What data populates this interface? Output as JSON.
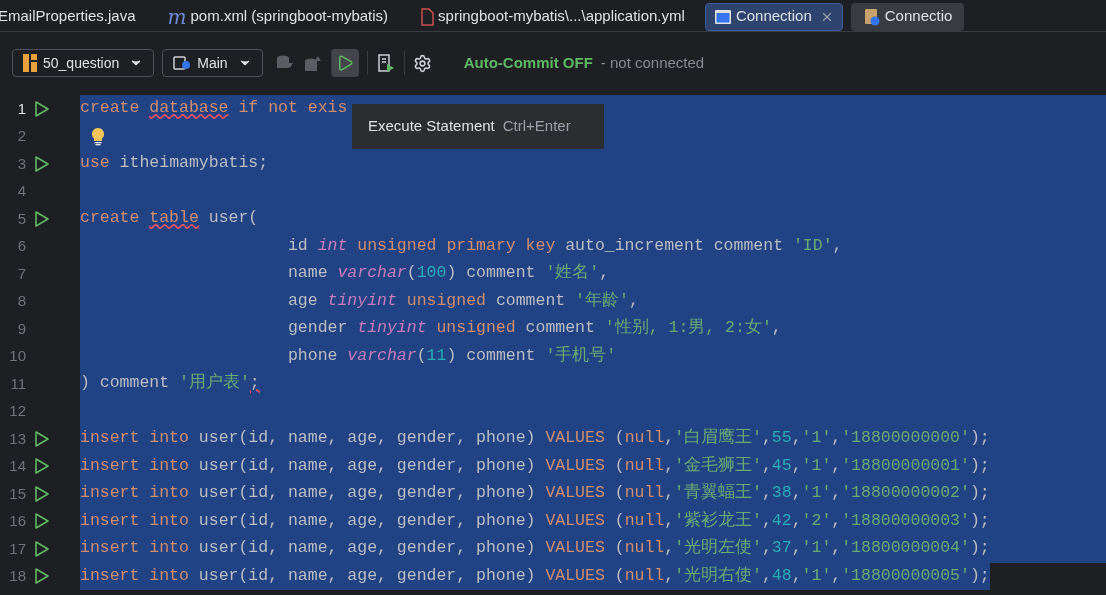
{
  "tabs": [
    {
      "label": "EmailProperties.java",
      "kind": "plain",
      "selected": false,
      "closable": false
    },
    {
      "label": "pom.xml (springboot-mybatis)",
      "kind": "maven",
      "glyph": "m",
      "selected": false,
      "closable": false
    },
    {
      "label": "springboot-mybatis\\...\\application.yml",
      "kind": "yaml",
      "selected": false,
      "closable": false
    },
    {
      "label": "Connection",
      "kind": "console",
      "selected": true,
      "closable": true
    },
    {
      "label": "Connectio",
      "kind": "datasource",
      "selected": false,
      "closable": false
    }
  ],
  "toolbar": {
    "datasource": "50_question",
    "schema": "Main",
    "commit_mode": "Auto-Commit OFF",
    "connection_status": "- not connected"
  },
  "tooltip": {
    "label": "Execute Statement",
    "shortcut": "Ctrl+Enter"
  },
  "lines": [
    {
      "number": "1",
      "run": true,
      "current": true,
      "bulb": false,
      "selected": true,
      "selection_to_edge": true,
      "tokens": [
        {
          "kind": "keyword",
          "text": "create "
        },
        {
          "kind": "keyword",
          "text": "database",
          "underline": true
        },
        {
          "kind": "keyword",
          "text": " if not exis"
        }
      ]
    },
    {
      "number": "2",
      "run": false,
      "current": false,
      "bulb": true,
      "selected": true,
      "selection_to_edge": true
    },
    {
      "number": "3",
      "run": true,
      "current": false,
      "bulb": false,
      "selected": true,
      "selection_to_edge": true,
      "tokens": [
        {
          "kind": "keyword",
          "text": "use"
        },
        {
          "kind": "plain",
          "text": " itheimamybatis;"
        }
      ]
    },
    {
      "number": "4",
      "run": false,
      "current": false,
      "bulb": false,
      "selected": true,
      "selection_to_edge": true
    },
    {
      "number": "5",
      "run": true,
      "current": false,
      "bulb": false,
      "selected": true,
      "selection_to_edge": true,
      "tokens": [
        {
          "kind": "keyword",
          "text": "create "
        },
        {
          "kind": "keyword",
          "text": "table",
          "underline": true
        },
        {
          "kind": "plain",
          "text": " user("
        }
      ]
    },
    {
      "number": "6",
      "run": false,
      "current": false,
      "bulb": false,
      "selected": true,
      "selection_to_edge": true,
      "tokens": [
        {
          "kind": "plain",
          "text": "                     id "
        },
        {
          "kind": "type",
          "text": "int"
        },
        {
          "kind": "keyword",
          "text": " unsigned primary key"
        },
        {
          "kind": "plain",
          "text": " auto_increment comment "
        },
        {
          "kind": "string",
          "text": "'ID'"
        },
        {
          "kind": "plain",
          "text": ","
        }
      ]
    },
    {
      "number": "7",
      "run": false,
      "current": false,
      "bulb": false,
      "selected": true,
      "selection_to_edge": true,
      "tokens": [
        {
          "kind": "plain",
          "text": "                     name "
        },
        {
          "kind": "type",
          "text": "varchar"
        },
        {
          "kind": "plain",
          "text": "("
        },
        {
          "kind": "number",
          "text": "100"
        },
        {
          "kind": "plain",
          "text": ") comment "
        },
        {
          "kind": "string",
          "text": "'姓名'"
        },
        {
          "kind": "plain",
          "text": ","
        }
      ]
    },
    {
      "number": "8",
      "run": false,
      "current": false,
      "bulb": false,
      "selected": true,
      "selection_to_edge": true,
      "tokens": [
        {
          "kind": "plain",
          "text": "                     age "
        },
        {
          "kind": "type",
          "text": "tinyint"
        },
        {
          "kind": "keyword",
          "text": " unsigned"
        },
        {
          "kind": "plain",
          "text": " comment "
        },
        {
          "kind": "string",
          "text": "'年龄'"
        },
        {
          "kind": "plain",
          "text": ","
        }
      ]
    },
    {
      "number": "9",
      "run": false,
      "current": false,
      "bulb": false,
      "selected": true,
      "selection_to_edge": true,
      "tokens": [
        {
          "kind": "plain",
          "text": "                     gender "
        },
        {
          "kind": "type",
          "text": "tinyint"
        },
        {
          "kind": "keyword",
          "text": " unsigned"
        },
        {
          "kind": "plain",
          "text": " comment "
        },
        {
          "kind": "string",
          "text": "'性别, 1:男, 2:女'"
        },
        {
          "kind": "plain",
          "text": ","
        }
      ]
    },
    {
      "number": "10",
      "run": false,
      "current": false,
      "bulb": false,
      "selected": true,
      "selection_to_edge": true,
      "tokens": [
        {
          "kind": "plain",
          "text": "                     phone "
        },
        {
          "kind": "type",
          "text": "varchar"
        },
        {
          "kind": "plain",
          "text": "("
        },
        {
          "kind": "number",
          "text": "11"
        },
        {
          "kind": "plain",
          "text": ") comment "
        },
        {
          "kind": "string",
          "text": "'手机号'"
        }
      ]
    },
    {
      "number": "11",
      "run": false,
      "current": false,
      "bulb": false,
      "selected": true,
      "selection_to_edge": true,
      "tokens": [
        {
          "kind": "plain",
          "text": ") comment "
        },
        {
          "kind": "string",
          "text": "'用户表'"
        },
        {
          "kind": "plain",
          "text": ";",
          "underline": true
        }
      ]
    },
    {
      "number": "12",
      "run": false,
      "current": false,
      "bulb": false,
      "selected": true,
      "selection_to_edge": true
    },
    {
      "number": "13",
      "run": true,
      "current": false,
      "bulb": false,
      "selected": true,
      "selection_to_edge": true,
      "tokens": [
        {
          "kind": "keyword",
          "text": "insert into"
        },
        {
          "kind": "plain",
          "text": " user(id, name, age, gender, phone) "
        },
        {
          "kind": "keyword",
          "text": "VALUES"
        },
        {
          "kind": "plain",
          "text": " ("
        },
        {
          "kind": "keyword",
          "text": "null"
        },
        {
          "kind": "plain",
          "text": ","
        },
        {
          "kind": "string",
          "text": "'白眉鹰王'"
        },
        {
          "kind": "plain",
          "text": ","
        },
        {
          "kind": "number",
          "text": "55"
        },
        {
          "kind": "plain",
          "text": ","
        },
        {
          "kind": "string",
          "text": "'1'"
        },
        {
          "kind": "plain",
          "text": ","
        },
        {
          "kind": "string",
          "text": "'18800000000'"
        },
        {
          "kind": "plain",
          "text": ");"
        }
      ]
    },
    {
      "number": "14",
      "run": true,
      "current": false,
      "bulb": false,
      "selected": true,
      "selection_to_edge": true,
      "tokens": [
        {
          "kind": "keyword",
          "text": "insert into"
        },
        {
          "kind": "plain",
          "text": " user(id, name, age, gender, phone) "
        },
        {
          "kind": "keyword",
          "text": "VALUES"
        },
        {
          "kind": "plain",
          "text": " ("
        },
        {
          "kind": "keyword",
          "text": "null"
        },
        {
          "kind": "plain",
          "text": ","
        },
        {
          "kind": "string",
          "text": "'金毛狮王'"
        },
        {
          "kind": "plain",
          "text": ","
        },
        {
          "kind": "number",
          "text": "45"
        },
        {
          "kind": "plain",
          "text": ","
        },
        {
          "kind": "string",
          "text": "'1'"
        },
        {
          "kind": "plain",
          "text": ","
        },
        {
          "kind": "string",
          "text": "'18800000001'"
        },
        {
          "kind": "plain",
          "text": ");"
        }
      ]
    },
    {
      "number": "15",
      "run": true,
      "current": false,
      "bulb": false,
      "selected": true,
      "selection_to_edge": true,
      "tokens": [
        {
          "kind": "keyword",
          "text": "insert into"
        },
        {
          "kind": "plain",
          "text": " user(id, name, age, gender, phone) "
        },
        {
          "kind": "keyword",
          "text": "VALUES"
        },
        {
          "kind": "plain",
          "text": " ("
        },
        {
          "kind": "keyword",
          "text": "null"
        },
        {
          "kind": "plain",
          "text": ","
        },
        {
          "kind": "string",
          "text": "'青翼蝠王'"
        },
        {
          "kind": "plain",
          "text": ","
        },
        {
          "kind": "number",
          "text": "38"
        },
        {
          "kind": "plain",
          "text": ","
        },
        {
          "kind": "string",
          "text": "'1'"
        },
        {
          "kind": "plain",
          "text": ","
        },
        {
          "kind": "string",
          "text": "'18800000002'"
        },
        {
          "kind": "plain",
          "text": ");"
        }
      ]
    },
    {
      "number": "16",
      "run": true,
      "current": false,
      "bulb": false,
      "selected": true,
      "selection_to_edge": true,
      "tokens": [
        {
          "kind": "keyword",
          "text": "insert into"
        },
        {
          "kind": "plain",
          "text": " user(id, name, age, gender, phone) "
        },
        {
          "kind": "keyword",
          "text": "VALUES"
        },
        {
          "kind": "plain",
          "text": " ("
        },
        {
          "kind": "keyword",
          "text": "null"
        },
        {
          "kind": "plain",
          "text": ","
        },
        {
          "kind": "string",
          "text": "'紫衫龙王'"
        },
        {
          "kind": "plain",
          "text": ","
        },
        {
          "kind": "number",
          "text": "42"
        },
        {
          "kind": "plain",
          "text": ","
        },
        {
          "kind": "string",
          "text": "'2'"
        },
        {
          "kind": "plain",
          "text": ","
        },
        {
          "kind": "string",
          "text": "'18800000003'"
        },
        {
          "kind": "plain",
          "text": ");"
        }
      ]
    },
    {
      "number": "17",
      "run": true,
      "current": false,
      "bulb": false,
      "selected": true,
      "selection_to_edge": true,
      "tokens": [
        {
          "kind": "keyword",
          "text": "insert into"
        },
        {
          "kind": "plain",
          "text": " user(id, name, age, gender, phone) "
        },
        {
          "kind": "keyword",
          "text": "VALUES"
        },
        {
          "kind": "plain",
          "text": " ("
        },
        {
          "kind": "keyword",
          "text": "null"
        },
        {
          "kind": "plain",
          "text": ","
        },
        {
          "kind": "string",
          "text": "'光明左使'"
        },
        {
          "kind": "plain",
          "text": ","
        },
        {
          "kind": "number",
          "text": "37"
        },
        {
          "kind": "plain",
          "text": ","
        },
        {
          "kind": "string",
          "text": "'1'"
        },
        {
          "kind": "plain",
          "text": ","
        },
        {
          "kind": "string",
          "text": "'18800000004'"
        },
        {
          "kind": "plain",
          "text": ");"
        }
      ]
    },
    {
      "number": "18",
      "run": true,
      "current": false,
      "bulb": false,
      "selected": true,
      "selection_to_edge": false,
      "tokens": [
        {
          "kind": "keyword",
          "text": "insert into"
        },
        {
          "kind": "plain",
          "text": " user(id, name, age, gender, phone) "
        },
        {
          "kind": "keyword",
          "text": "VALUES"
        },
        {
          "kind": "plain",
          "text": " ("
        },
        {
          "kind": "keyword",
          "text": "null"
        },
        {
          "kind": "plain",
          "text": ","
        },
        {
          "kind": "string",
          "text": "'光明右使'"
        },
        {
          "kind": "plain",
          "text": ","
        },
        {
          "kind": "number",
          "text": "48"
        },
        {
          "kind": "plain",
          "text": ","
        },
        {
          "kind": "string",
          "text": "'1'"
        },
        {
          "kind": "plain",
          "text": ","
        },
        {
          "kind": "string",
          "text": "'18800000005'"
        },
        {
          "kind": "plain",
          "text": ");"
        }
      ]
    }
  ]
}
